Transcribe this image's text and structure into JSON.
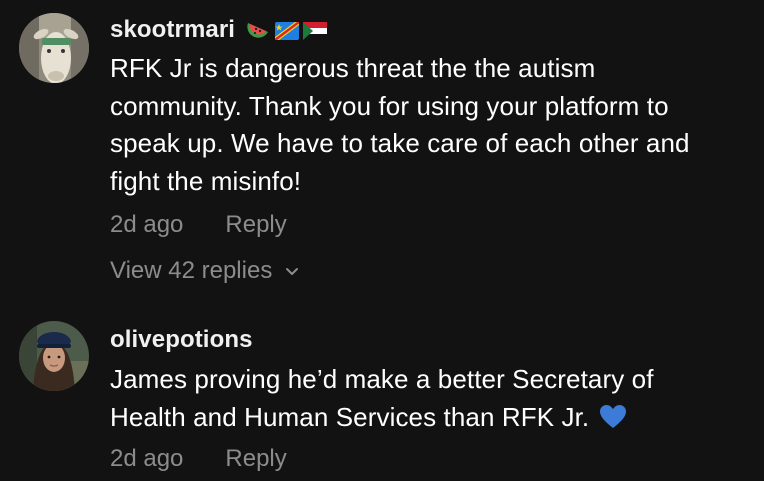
{
  "comments": [
    {
      "username": "skootrmari",
      "flair_icons": [
        "watermelon-emoji",
        "dr-congo-flag-emoji",
        "sudan-flag-emoji"
      ],
      "text": "RFK Jr is dangerous threat the the autism\ncommunity. Thank you for using your platform to\nspeak up. We have to take care of each other and\nfight the misinfo!",
      "time": "2d ago",
      "reply_label": "Reply",
      "view_replies_label": "View 42 replies"
    },
    {
      "username": "olivepotions",
      "text": "James proving he’d make a better Secretary of\nHealth and Human Services than RFK Jr.",
      "trailing_emoji": "blue-heart-emoji",
      "time": "2d ago",
      "reply_label": "Reply"
    }
  ],
  "colors": {
    "background": "#121212",
    "text_primary": "#ffffff",
    "text_secondary": "#8c8c8c",
    "heart": "#3d7bd9"
  }
}
